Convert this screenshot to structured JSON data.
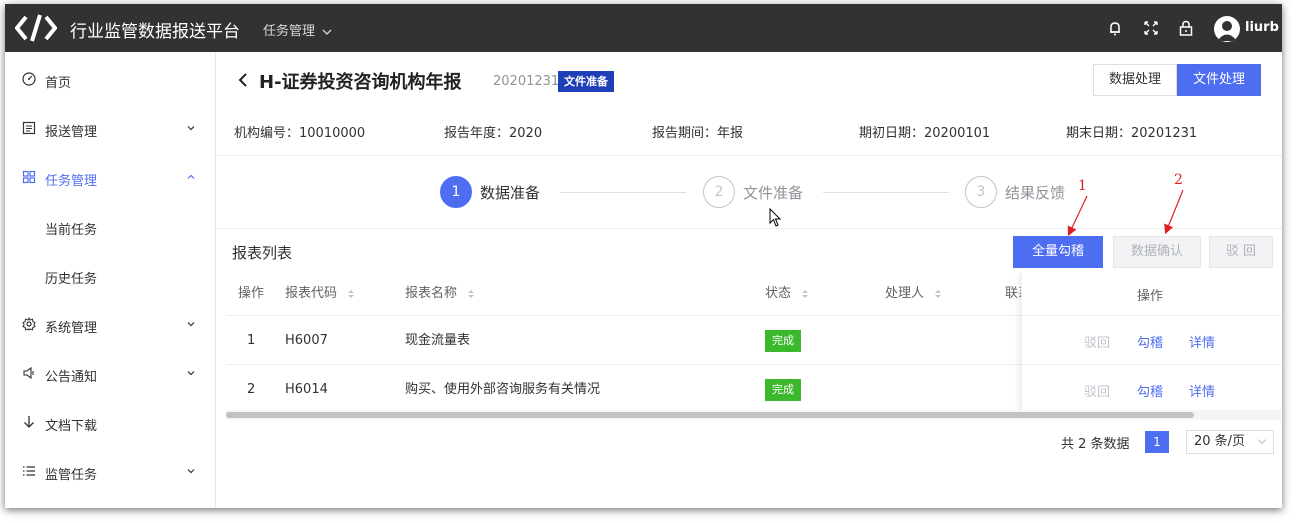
{
  "header": {
    "app_title": "行业监管数据报送平台",
    "top_menu": "任务管理",
    "username": "liurb",
    "icons": [
      "bell-icon",
      "fullscreen-icon",
      "lock-icon",
      "user-avatar-icon"
    ]
  },
  "sidebar": {
    "items": [
      {
        "label": "首页",
        "icon": "dashboard-icon"
      },
      {
        "label": "报送管理",
        "icon": "list-icon"
      },
      {
        "label": "任务管理",
        "icon": "grid-icon"
      },
      {
        "label": "当前任务"
      },
      {
        "label": "历史任务"
      },
      {
        "label": "系统管理",
        "icon": "gear-icon"
      },
      {
        "label": "公告通知",
        "icon": "speaker-icon"
      },
      {
        "label": "文档下载",
        "icon": "download-icon"
      },
      {
        "label": "监管任务",
        "icon": "menu-list-icon"
      }
    ],
    "active_color": "#4e6ef2"
  },
  "page": {
    "title": "H-证券投资咨询机构年报",
    "date": "20201231",
    "badge": "文件准备",
    "btn_data": "数据处理",
    "btn_file": "文件处理"
  },
  "info": {
    "org": "机构编号：10010000",
    "year": "报告年度：2020",
    "period": "报告期间：年报",
    "start": "期初日期：20200101",
    "end": "期末日期：20201231"
  },
  "steps": [
    {
      "num": "1",
      "label": "数据准备"
    },
    {
      "num": "2",
      "label": "文件准备"
    },
    {
      "num": "3",
      "label": "结果反馈"
    }
  ],
  "annotations": {
    "a1": "1",
    "a2": "2"
  },
  "table": {
    "title": "报表列表",
    "btn_check_all": "全量勾稽",
    "btn_confirm": "数据确认",
    "btn_reject": "驳 回",
    "headers": {
      "op": "操作",
      "code": "报表代码",
      "name": "报表名称",
      "status": "状态",
      "handler": "处理人",
      "contact": "联系",
      "actions": "操作"
    },
    "rows": [
      {
        "no": "1",
        "code": "H6007",
        "name": "现金流量表",
        "status": "完成",
        "reject": "驳回",
        "check": "勾稽",
        "detail": "详情"
      },
      {
        "no": "2",
        "code": "H6014",
        "name": "购买、使用外部咨询服务有关情况",
        "status": "完成",
        "reject": "驳回",
        "check": "勾稽",
        "detail": "详情"
      }
    ]
  },
  "pagination": {
    "total": "共 2 条数据",
    "current": "1",
    "page_size": "20 条/页"
  },
  "colors": {
    "primary": "#4e6ef2",
    "header_bg": "#323233",
    "badge": "#1f3fb8",
    "success": "#3cb82c",
    "annotation": "#e02020"
  }
}
